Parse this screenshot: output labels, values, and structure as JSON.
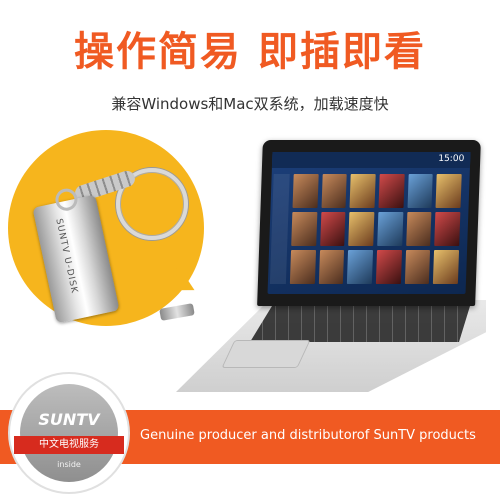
{
  "hero": {
    "headline": "操作简易  即插即看",
    "subline": "兼容Windows和Mac双系统，加载速度快"
  },
  "usb": {
    "label": "SUNTV U-DISK"
  },
  "laptop": {
    "screen_time": "15:00"
  },
  "banner": {
    "text": "Genuine producer and distributorof SunTV products"
  },
  "badge": {
    "brand": "SUNTV",
    "ribbon": "中文电视服务",
    "sub": "inside"
  },
  "colors": {
    "accent": "#f05a22",
    "callout": "#f6b51d",
    "ribbon_red": "#d72b1e"
  }
}
